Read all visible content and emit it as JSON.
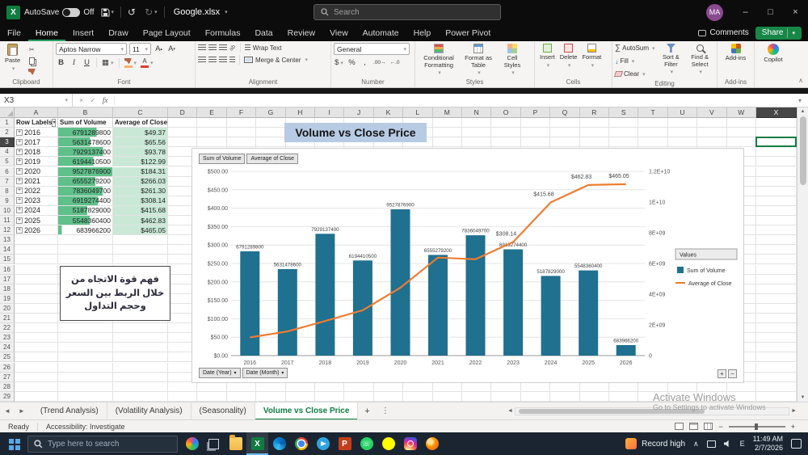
{
  "icons": {
    "dropdown": "▾",
    "tri_up": "▴",
    "tri_down": "▾",
    "undo": "↺",
    "redo": "↻",
    "minimize": "–",
    "maximize": "□",
    "close": "×",
    "check": "✓",
    "fx": "fx",
    "cut": "✂",
    "bold": "B",
    "italic": "I",
    "underline": "U",
    "borders": "▦",
    "autosum": "∑",
    "fill_down": "↓",
    "left_arrow": "◄",
    "right_arrow": "►",
    "up_arrow": "▲",
    "down_arrow": "▼",
    "plus": "+",
    "minus": "−",
    "kebab": "⋮",
    "chevron_up": "∧",
    "currency": "$",
    "percent": "%",
    "comma": ",",
    "increase_decimal": ".00→",
    "decrease_decimal": "←.0",
    "expand": "+"
  },
  "titlebar": {
    "autosave_label": "AutoSave",
    "autosave_state": "Off",
    "filename": "Google.xlsx",
    "search_placeholder": "Search",
    "avatar_initials": "MA"
  },
  "menubar": {
    "tabs": [
      "File",
      "Home",
      "Insert",
      "Draw",
      "Page Layout",
      "Formulas",
      "Data",
      "Review",
      "View",
      "Automate",
      "Help",
      "Power Pivot"
    ],
    "active_tab": "Home",
    "comments_label": "Comments",
    "share_label": "Share"
  },
  "ribbon": {
    "clipboard": {
      "paste": "Paste",
      "group": "Clipboard"
    },
    "font": {
      "name": "Aptos Narrow",
      "size": "11",
      "group": "Font"
    },
    "alignment": {
      "wrap": "Wrap Text",
      "merge": "Merge & Center",
      "group": "Alignment"
    },
    "number": {
      "format": "General",
      "group": "Number"
    },
    "styles": {
      "conditional": "Conditional Formatting",
      "format_table": "Format as Table",
      "cell_styles": "Cell Styles",
      "group": "Styles"
    },
    "cells": {
      "insert": "Insert",
      "delete": "Delete",
      "format": "Format",
      "group": "Cells"
    },
    "editing": {
      "autosum": "AutoSum",
      "fill": "Fill",
      "clear": "Clear",
      "sort": "Sort & Filter",
      "find": "Find & Select",
      "group": "Editing"
    },
    "addins": {
      "label": "Add-ins",
      "group": "Add-ins"
    },
    "copilot": {
      "label": "Copilot",
      "group": "Copilot"
    }
  },
  "formula_bar": {
    "name_box": "X3"
  },
  "sheet": {
    "selected_cell": "X3",
    "columns": [
      "A",
      "B",
      "C",
      "D",
      "E",
      "F",
      "G",
      "H",
      "I",
      "J",
      "K",
      "L",
      "M",
      "N",
      "O",
      "P",
      "Q",
      "R",
      "S",
      "T",
      "U",
      "V",
      "W",
      "X"
    ],
    "row_count": 29,
    "pivot": {
      "headers": [
        "Row Labels",
        "Sum of Volume",
        "Average of Close"
      ]
    },
    "title_cell": "Volume vs Close Price",
    "note_text": "فهم قوة الاتجاه من خلال الربط بين السعر وحجم التداول"
  },
  "chart_data": {
    "type": "combo",
    "title": "Volume vs Close Price",
    "categories": [
      "2016",
      "2017",
      "2018",
      "2019",
      "2020",
      "2021",
      "2022",
      "2023",
      "2024",
      "2025",
      "2026"
    ],
    "series": [
      {
        "name": "Sum of Volume",
        "type": "bar",
        "axis": "right",
        "color": "#20708f",
        "values": [
          6791289800,
          5631478600,
          7929137400,
          6194410500,
          9527876900,
          6555279200,
          7836049700,
          6919274400,
          5187829000,
          5548360400,
          683966200
        ]
      },
      {
        "name": "Average of Close",
        "type": "line",
        "axis": "left",
        "color": "#ed7d31",
        "values": [
          49.37,
          65.56,
          93.78,
          122.99,
          184.31,
          266.03,
          261.3,
          308.14,
          415.68,
          462.83,
          465.05
        ]
      }
    ],
    "left_axis": {
      "min": 0,
      "max": 500,
      "step": 50,
      "tick_labels": [
        "$0.00",
        "$50.00",
        "$100.00",
        "$150.00",
        "$200.00",
        "$250.00",
        "$300.00",
        "$350.00",
        "$400.00",
        "$450.00",
        "$500.00"
      ]
    },
    "right_axis": {
      "min": 0,
      "max": 12000000000,
      "tick_labels": [
        "0",
        "2E+09",
        "4E+09",
        "6E+09",
        "8E+09",
        "1E+10",
        "1.2E+10"
      ]
    },
    "legend": {
      "title": "Values",
      "entries": [
        "Sum of Volume",
        "Average of Close"
      ],
      "position": "right"
    },
    "field_buttons": [
      "Sum of Volume",
      "Average of Close"
    ],
    "axis_field_buttons": [
      "Date (Year)",
      "Date (Month)"
    ],
    "line_point_labels": [
      {
        "i": 7,
        "label": "$308.14"
      },
      {
        "i": 8,
        "label": "$415.68"
      },
      {
        "i": 9,
        "label": "$462.83"
      },
      {
        "i": 10,
        "label": "$465.05"
      }
    ],
    "grid": true
  },
  "tabs_bar": {
    "sheets": [
      "(Trend Analysis)",
      "(Volatility Analysis)",
      "(Seasonality)",
      "Volume vs Close Price"
    ],
    "active_sheet": "Volume vs Close Price"
  },
  "status_bar": {
    "mode": "Ready",
    "accessibility": "Accessibility: Investigate"
  },
  "watermark": {
    "line1": "Activate Windows",
    "line2": "Go to Settings to activate Windows"
  },
  "taskbar": {
    "search_placeholder": "Type here to search",
    "apps": [
      "copilot",
      "task-view",
      "file-explorer",
      "excel",
      "edge",
      "chrome",
      "telegram",
      "powerpoint",
      "whatsapp",
      "snapchat",
      "instagram",
      "firefox"
    ],
    "active_app": "excel",
    "widget_label": "Record high",
    "tray_lang": "E",
    "time": "11:49 AM",
    "date": "2/7/2026"
  }
}
